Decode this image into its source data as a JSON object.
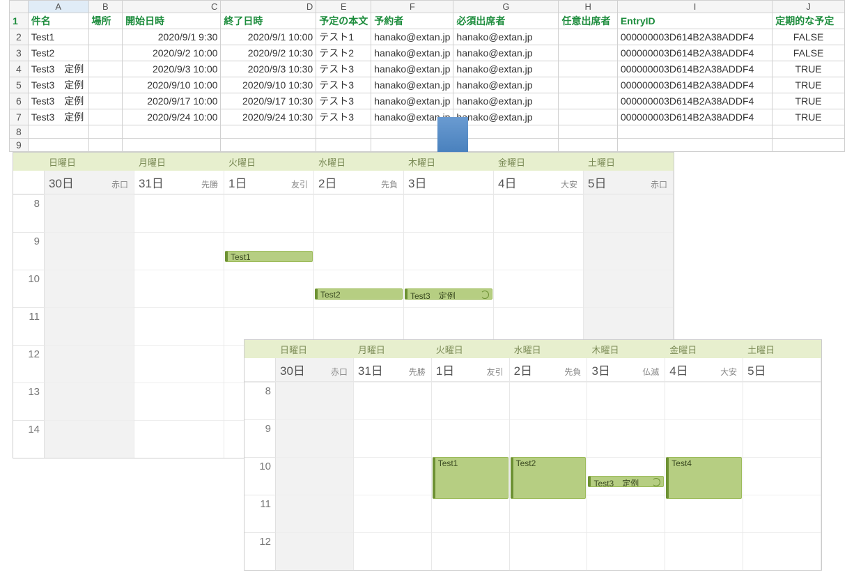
{
  "excel": {
    "col_letters": [
      "A",
      "B",
      "C",
      "D",
      "E",
      "F",
      "G",
      "H",
      "I",
      "J"
    ],
    "headers": [
      "件名",
      "場所",
      "開始日時",
      "終了日時",
      "予定の本文",
      "予約者",
      "必須出席者",
      "任意出席者",
      "EntryID",
      "定期的な予定"
    ],
    "rows": [
      {
        "subject": "Test1",
        "location": "",
        "start": "2020/9/1 9:30",
        "end": "2020/9/1 10:00",
        "body": "テスト1",
        "organizer": "hanako@extan.jp",
        "required": "hanako@extan.jp",
        "optional": "",
        "entryid": "000000003D614B2A38ADDF4",
        "recurring": "FALSE"
      },
      {
        "subject": "Test2",
        "location": "",
        "start": "2020/9/2 10:00",
        "end": "2020/9/2 10:30",
        "body": "テスト2",
        "organizer": "hanako@extan.jp",
        "required": "hanako@extan.jp",
        "optional": "",
        "entryid": "000000003D614B2A38ADDF4",
        "recurring": "FALSE"
      },
      {
        "subject": "Test3　定例",
        "location": "",
        "start": "2020/9/3 10:00",
        "end": "2020/9/3 10:30",
        "body": "テスト3",
        "organizer": "hanako@extan.jp",
        "required": "hanako@extan.jp",
        "optional": "",
        "entryid": "000000003D614B2A38ADDF4",
        "recurring": "TRUE"
      },
      {
        "subject": "Test3　定例",
        "location": "",
        "start": "2020/9/10 10:00",
        "end": "2020/9/10 10:30",
        "body": "テスト3",
        "organizer": "hanako@extan.jp",
        "required": "hanako@extan.jp",
        "optional": "",
        "entryid": "000000003D614B2A38ADDF4",
        "recurring": "TRUE"
      },
      {
        "subject": "Test3　定例",
        "location": "",
        "start": "2020/9/17 10:00",
        "end": "2020/9/17 10:30",
        "body": "テスト3",
        "organizer": "hanako@extan.jp",
        "required": "hanako@extan.jp",
        "optional": "",
        "entryid": "000000003D614B2A38ADDF4",
        "recurring": "TRUE"
      },
      {
        "subject": "Test3　定例",
        "location": "",
        "start": "2020/9/24 10:00",
        "end": "2020/9/24 10:30",
        "body": "テスト3",
        "organizer": "hanako@extan.jp",
        "required": "hanako@extan.jp",
        "optional": "",
        "entryid": "000000003D614B2A38ADDF4",
        "recurring": "TRUE"
      }
    ],
    "blank_rows": [
      "8",
      "9"
    ]
  },
  "cal1": {
    "days": [
      "日曜日",
      "月曜日",
      "火曜日",
      "水曜日",
      "木曜日",
      "金曜日",
      "土曜日"
    ],
    "dates": [
      {
        "d": "30日",
        "r": "赤口",
        "shade": true
      },
      {
        "d": "31日",
        "r": "先勝",
        "shade": false
      },
      {
        "d": "1日",
        "r": "友引",
        "shade": false
      },
      {
        "d": "2日",
        "r": "先負",
        "shade": false
      },
      {
        "d": "3日",
        "r": "",
        "shade": false
      },
      {
        "d": "4日",
        "r": "大安",
        "shade": false
      },
      {
        "d": "5日",
        "r": "赤口",
        "shade": true
      }
    ],
    "hours": [
      "8",
      "9",
      "10",
      "11",
      "12",
      "13",
      "14"
    ],
    "events": [
      {
        "col": 2,
        "hourStart": 1,
        "cls": "short",
        "title": "Test1",
        "recur": false
      },
      {
        "col": 3,
        "hourStart": 2,
        "cls": "short",
        "title": "Test2",
        "recur": false
      },
      {
        "col": 4,
        "hourStart": 2,
        "cls": "short",
        "title": "Test3　定例",
        "recur": true
      }
    ]
  },
  "cal2": {
    "days": [
      "日曜日",
      "月曜日",
      "火曜日",
      "水曜日",
      "木曜日",
      "金曜日",
      "土曜日"
    ],
    "dates": [
      {
        "d": "30日",
        "r": "赤口",
        "shade": true
      },
      {
        "d": "31日",
        "r": "先勝",
        "shade": false
      },
      {
        "d": "1日",
        "r": "友引",
        "shade": false
      },
      {
        "d": "2日",
        "r": "先負",
        "shade": false
      },
      {
        "d": "3日",
        "r": "仏滅",
        "shade": false
      },
      {
        "d": "4日",
        "r": "大安",
        "shade": false
      },
      {
        "d": "5日",
        "r": "",
        "shade": false
      }
    ],
    "hours": [
      "8",
      "9",
      "10",
      "11",
      "12"
    ],
    "events": [
      {
        "col": 2,
        "hourStart": 2,
        "cls": "tall",
        "title": "Test1",
        "recur": false
      },
      {
        "col": 3,
        "hourStart": 2,
        "cls": "tall",
        "title": "Test2",
        "recur": false
      },
      {
        "col": 4,
        "hourStart": 2,
        "cls": "short",
        "title": "Test3　定例",
        "recur": true
      },
      {
        "col": 5,
        "hourStart": 2,
        "cls": "tall",
        "title": "Test4",
        "recur": false
      }
    ]
  }
}
